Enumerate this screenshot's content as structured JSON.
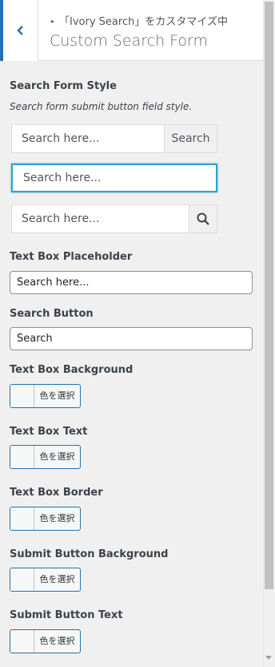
{
  "header": {
    "breadcrumb": "「Ivory Search」をカスタマイズ中",
    "title": "Custom Search Form"
  },
  "search_form_style": {
    "title": "Search Form Style",
    "description": "Search form submit button field style.",
    "style1": {
      "placeholder": "Search here...",
      "button_label": "Search"
    },
    "style2": {
      "placeholder": "Search here..."
    },
    "style3": {
      "placeholder": "Search here..."
    }
  },
  "text_box_placeholder": {
    "title": "Text Box Placeholder",
    "value": "Search here..."
  },
  "search_button": {
    "title": "Search Button",
    "value": "Search"
  },
  "color_settings": [
    {
      "title": "Text Box Background",
      "button_label": "色を選択"
    },
    {
      "title": "Text Box Text",
      "button_label": "色を選択"
    },
    {
      "title": "Text Box Border",
      "button_label": "色を選択"
    },
    {
      "title": "Submit Button Background",
      "button_label": "色を選択"
    },
    {
      "title": "Submit Button Text",
      "button_label": "色を選択"
    }
  ],
  "icons": {
    "back": "chevron-left-icon",
    "search": "search-icon"
  },
  "colors": {
    "accent": "#2271b1",
    "focus": "#2ea2cc"
  }
}
